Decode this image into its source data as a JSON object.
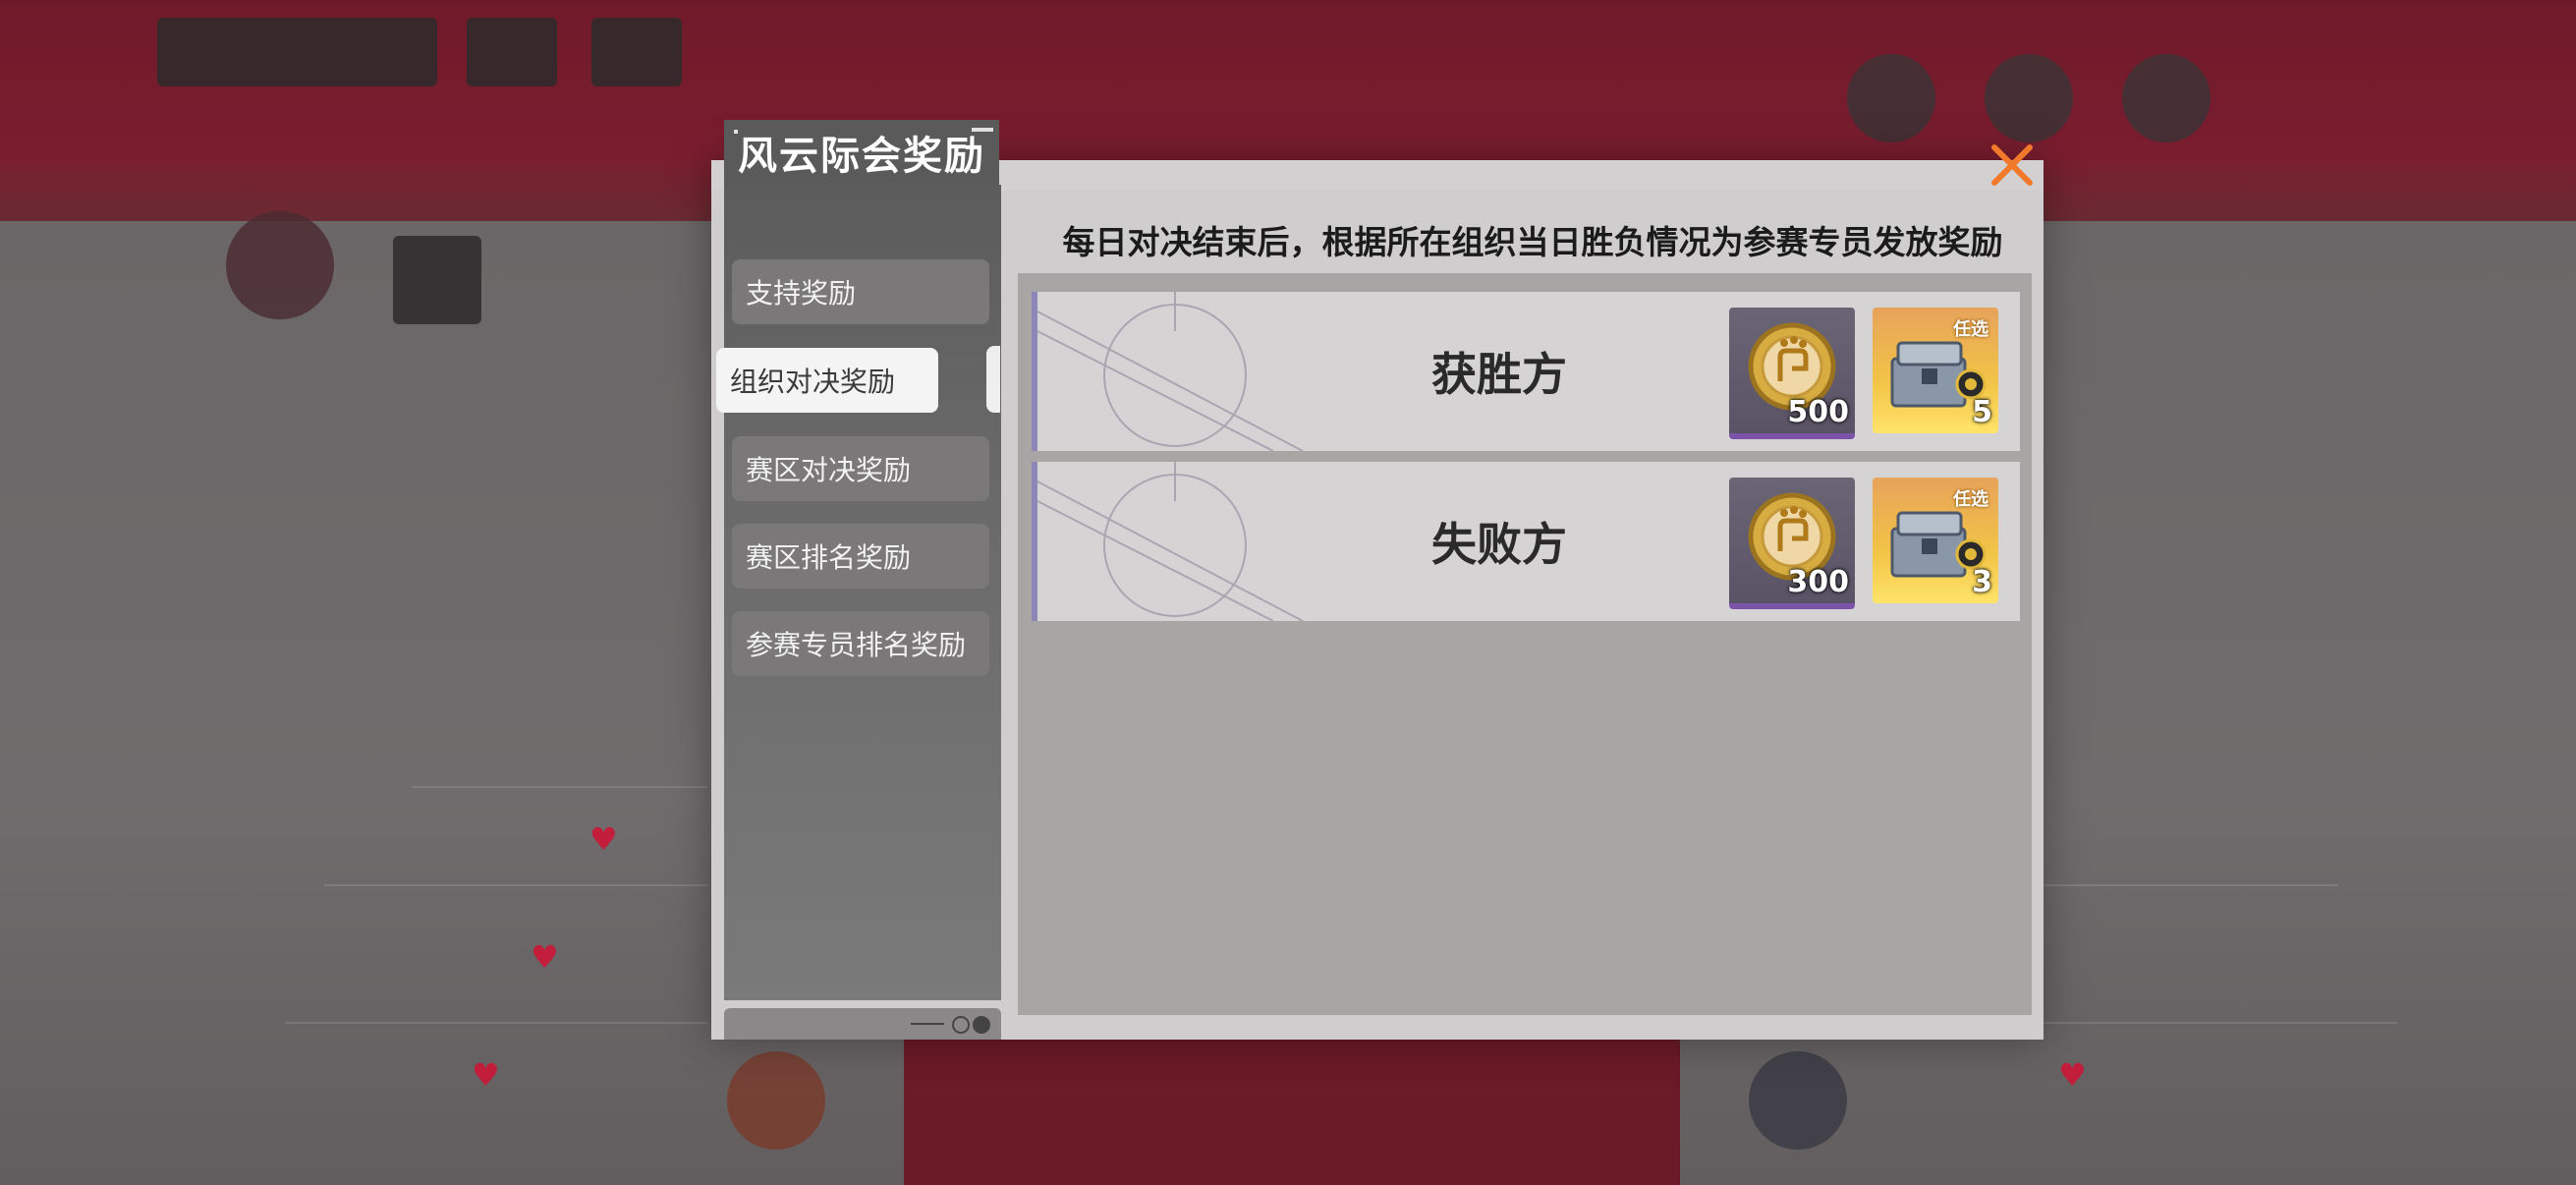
{
  "modal": {
    "title": "风云际会奖励",
    "description": "每日对决结束后，根据所在组织当日胜负情况为参赛专员发放奖励"
  },
  "sidebar": {
    "items": [
      {
        "label": "支持奖励",
        "active": false
      },
      {
        "label": "组织对决奖励",
        "active": true
      },
      {
        "label": "赛区对决奖励",
        "active": false
      },
      {
        "label": "赛区排名奖励",
        "active": false
      },
      {
        "label": "参赛专员排名奖励",
        "active": false
      }
    ]
  },
  "rewards": [
    {
      "label": "获胜方",
      "items": [
        {
          "icon": "coin-icon",
          "quantity": "500"
        },
        {
          "icon": "chest-icon",
          "tag": "任选",
          "quantity": "5"
        }
      ]
    },
    {
      "label": "失败方",
      "items": [
        {
          "icon": "coin-icon",
          "quantity": "300"
        },
        {
          "icon": "chest-icon",
          "tag": "任选",
          "quantity": "3"
        }
      ]
    }
  ],
  "colors": {
    "close_accent": "#f07a2a",
    "row_accent": "#8d86b8",
    "coin_bar": "#7b53a8",
    "background_red": "#7a1d2f"
  }
}
